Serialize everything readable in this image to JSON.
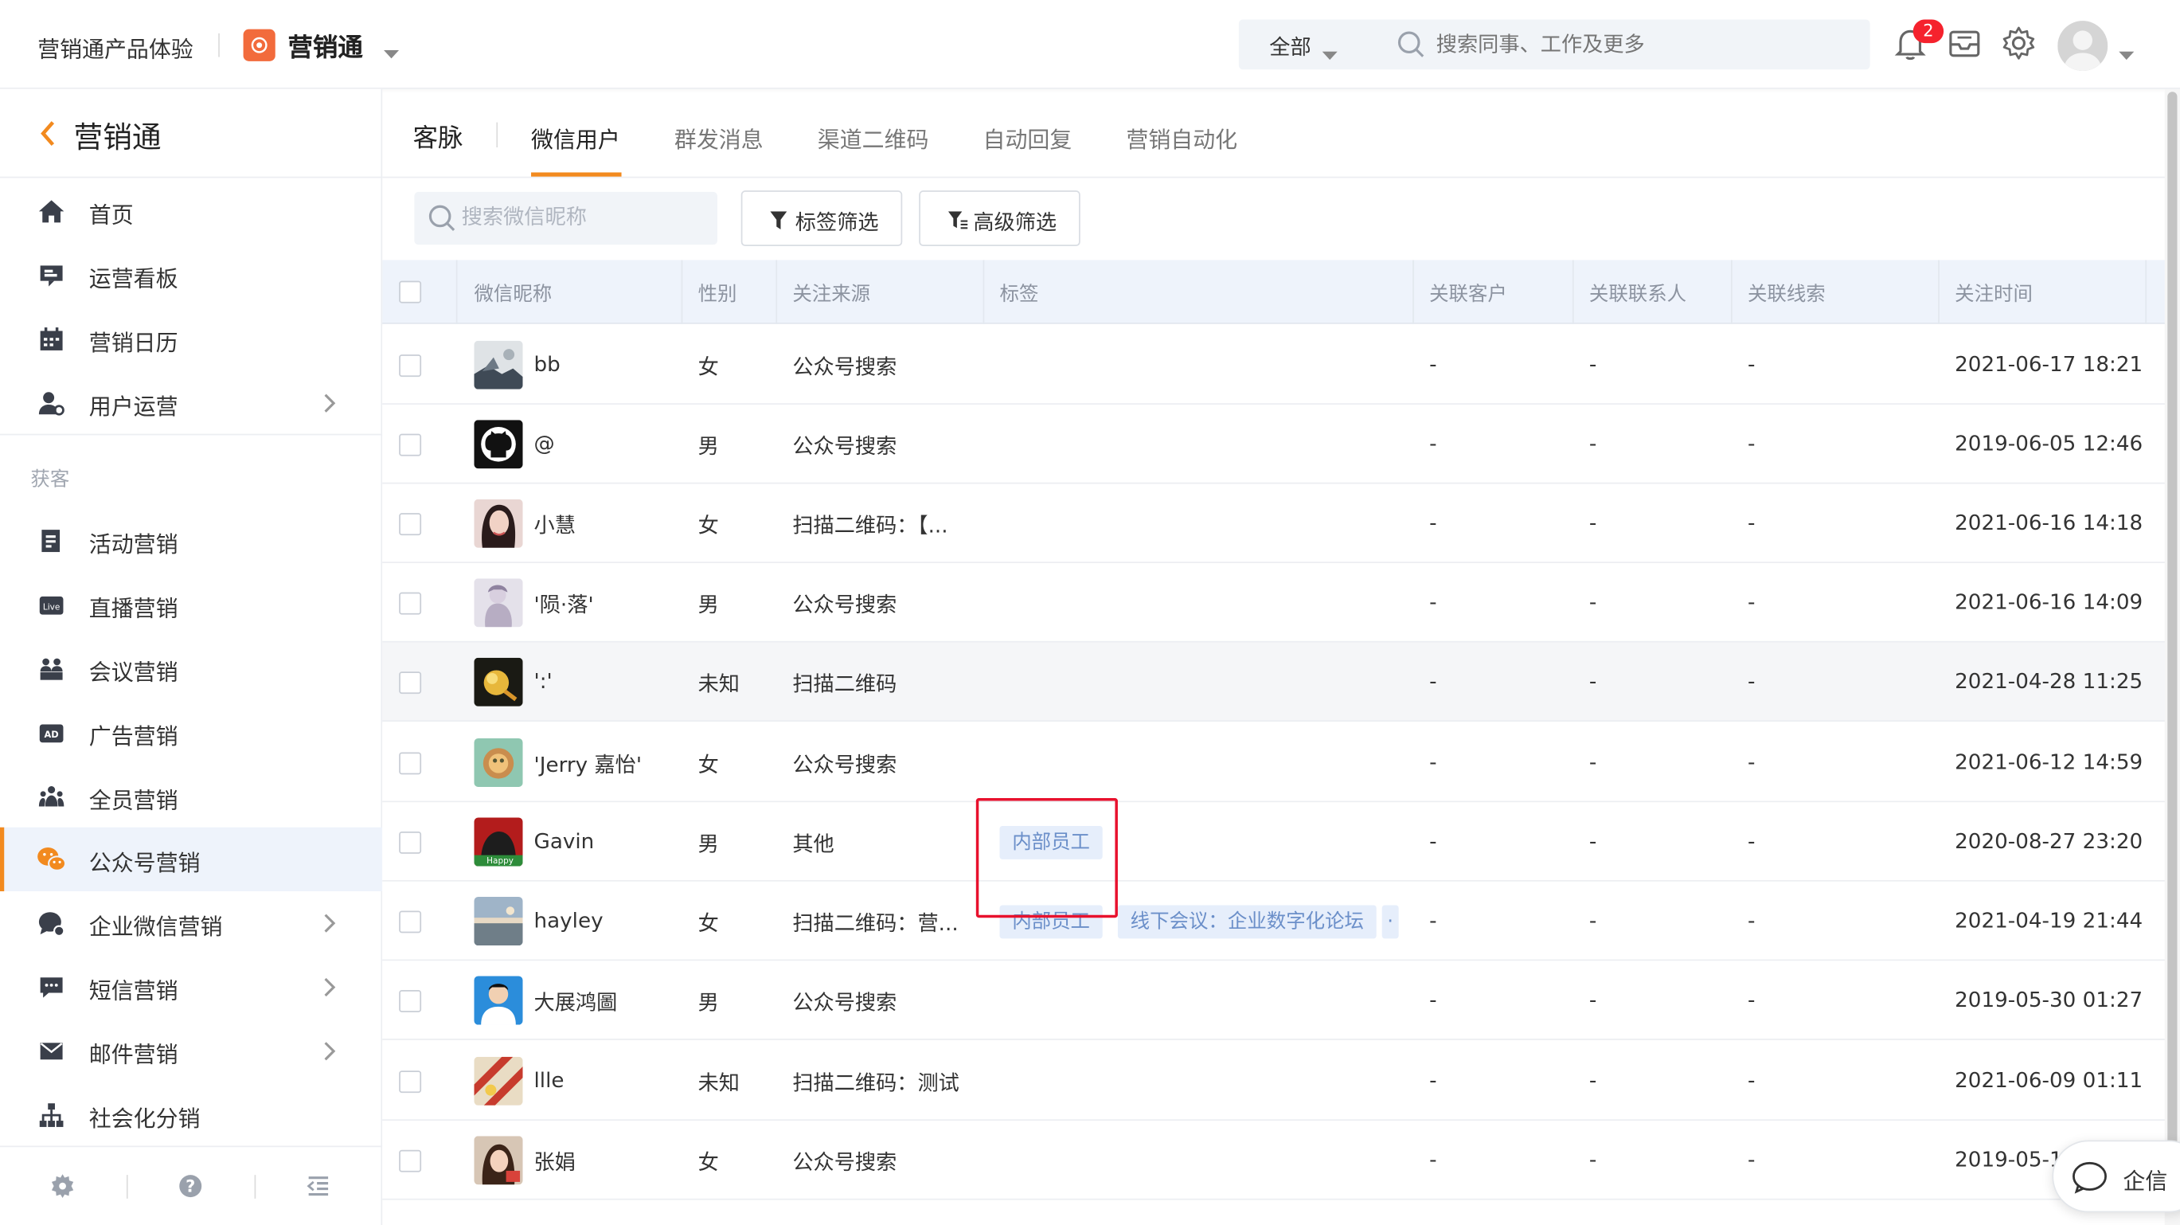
{
  "topbar": {
    "product_title": "营销通产品体验",
    "app_name": "营销通",
    "search_scope": "全部",
    "search_placeholder": "搜索同事、工作及更多",
    "notification_count": "2"
  },
  "sidebar": {
    "title": "营销通",
    "items_top": [
      {
        "label": "首页",
        "icon": "home-icon"
      },
      {
        "label": "运营看板",
        "icon": "dashboard-icon"
      },
      {
        "label": "营销日历",
        "icon": "calendar-icon"
      },
      {
        "label": "用户运营",
        "icon": "user-ops-icon",
        "has_arrow": true
      }
    ],
    "section_label": "获客",
    "items_acq": [
      {
        "label": "活动营销",
        "icon": "activity-icon"
      },
      {
        "label": "直播营销",
        "icon": "live-icon"
      },
      {
        "label": "会议营销",
        "icon": "meeting-icon"
      },
      {
        "label": "广告营销",
        "icon": "ad-icon"
      },
      {
        "label": "全员营销",
        "icon": "team-icon"
      },
      {
        "label": "公众号营销",
        "icon": "wechat-icon",
        "active": true
      },
      {
        "label": "企业微信营销",
        "icon": "work-wechat-icon",
        "has_arrow": true
      },
      {
        "label": "短信营销",
        "icon": "sms-icon",
        "has_arrow": true
      },
      {
        "label": "邮件营销",
        "icon": "mail-icon",
        "has_arrow": true
      },
      {
        "label": "社会化分销",
        "icon": "distribution-icon"
      }
    ]
  },
  "tabs": {
    "section": "客脉",
    "items": [
      "微信用户",
      "群发消息",
      "渠道二维码",
      "自动回复",
      "营销自动化"
    ],
    "active_index": 0
  },
  "toolbar": {
    "search_placeholder": "搜索微信昵称",
    "tag_filter": "标签筛选",
    "adv_filter": "高级筛选"
  },
  "table": {
    "columns": [
      "微信昵称",
      "性别",
      "关注来源",
      "标签",
      "关联客户",
      "关联联系人",
      "关联线索",
      "关注时间"
    ],
    "rows": [
      {
        "nick": "bb",
        "gender": "女",
        "source": "公众号搜索",
        "tags": [],
        "customer": "-",
        "contact": "-",
        "lead": "-",
        "time": "2021-06-17 18:21"
      },
      {
        "nick": "@",
        "gender": "男",
        "source": "公众号搜索",
        "tags": [],
        "customer": "-",
        "contact": "-",
        "lead": "-",
        "time": "2019-06-05 12:46"
      },
      {
        "nick": "小慧",
        "gender": "女",
        "source": "扫描二维码：【...",
        "tags": [],
        "customer": "-",
        "contact": "-",
        "lead": "-",
        "time": "2021-06-16 14:18"
      },
      {
        "nick": "'陨·落'",
        "gender": "男",
        "source": "公众号搜索",
        "tags": [],
        "customer": "-",
        "contact": "-",
        "lead": "-",
        "time": "2021-06-16 14:09"
      },
      {
        "nick": "':'",
        "gender": "未知",
        "source": "扫描二维码",
        "tags": [],
        "customer": "-",
        "contact": "-",
        "lead": "-",
        "time": "2021-04-28 11:25"
      },
      {
        "nick": "'Jerry 嘉怡'",
        "gender": "女",
        "source": "公众号搜索",
        "tags": [],
        "customer": "-",
        "contact": "-",
        "lead": "-",
        "time": "2021-06-12 14:59"
      },
      {
        "nick": "Gavin",
        "gender": "男",
        "source": "其他",
        "tags": [
          "内部员工"
        ],
        "customer": "-",
        "contact": "-",
        "lead": "-",
        "time": "2020-08-27 23:20"
      },
      {
        "nick": "hayley",
        "gender": "女",
        "source": "扫描二维码：营...",
        "tags": [
          "内部员工",
          "线下会议：企业数字化论坛"
        ],
        "customer": "-",
        "contact": "-",
        "lead": "-",
        "time": "2021-04-19 21:44"
      },
      {
        "nick": "大展鸿圖",
        "gender": "男",
        "source": "公众号搜索",
        "tags": [],
        "customer": "-",
        "contact": "-",
        "lead": "-",
        "time": "2019-05-30 01:27"
      },
      {
        "nick": "llle",
        "gender": "未知",
        "source": "扫描二维码：测试",
        "tags": [],
        "customer": "-",
        "contact": "-",
        "lead": "-",
        "time": "2021-06-09 01:11"
      },
      {
        "nick": "张娟",
        "gender": "女",
        "source": "公众号搜索",
        "tags": [],
        "customer": "-",
        "contact": "-",
        "lead": "-",
        "time": "2019-05-14"
      }
    ]
  },
  "floating": {
    "label": "企信"
  },
  "colors": {
    "accent": "#f28a1f",
    "header_bg": "#eef3fb",
    "tag_bg": "#e6eefb",
    "tag_text": "#6b8fc9",
    "highlight_border": "#e8112d",
    "badge": "#f5222d"
  }
}
